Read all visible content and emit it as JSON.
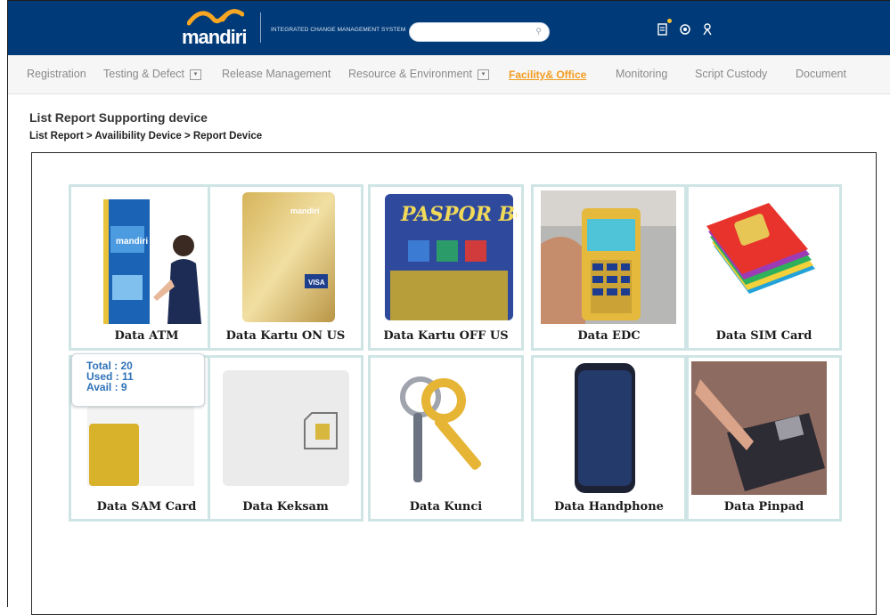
{
  "header": {
    "brand": "mandiri",
    "system_title": "INTEGRATED CHANGE MANAGEMENT SYSTEM",
    "search_placeholder": "",
    "icons": [
      "report-icon",
      "settings-icon",
      "user-icon"
    ],
    "colors": {
      "header_bg": "#003a78",
      "nav_active": "#f29b1d"
    }
  },
  "nav": {
    "items": [
      {
        "label": "Registration"
      },
      {
        "label": "Testing & Defect"
      },
      {
        "label": "Release  Management"
      },
      {
        "label": "Resource & Environment"
      },
      {
        "label": "Facility& Office"
      },
      {
        "label": "Monitoring"
      },
      {
        "label": "Script Custody"
      },
      {
        "label": "Document"
      }
    ]
  },
  "page": {
    "title": "List Report Supporting device",
    "breadcrumb": "List Report > Availibility Device > Report Device"
  },
  "devices": [
    {
      "label": "Data ATM",
      "image": "atm-image"
    },
    {
      "label": "Data Kartu ON US",
      "image": "gold-card-image"
    },
    {
      "label": "Data Kartu OFF US",
      "image": "bca-passport-card-image"
    },
    {
      "label": "Data EDC",
      "image": "edc-terminal-image"
    },
    {
      "label": "Data SIM Card",
      "image": "sim-cards-image"
    },
    {
      "label": "Data SAM Card",
      "image": "sam-card-image"
    },
    {
      "label": "Data Keksam",
      "image": "keksam-card-image"
    },
    {
      "label": "Data Kunci",
      "image": "keys-image"
    },
    {
      "label": "Data Handphone",
      "image": "smartphone-image"
    },
    {
      "label": "Data Pinpad",
      "image": "pinpad-image"
    }
  ],
  "tooltip": {
    "total": "Total : 20",
    "used": "Used : 11",
    "avail": "Avail : 9"
  }
}
